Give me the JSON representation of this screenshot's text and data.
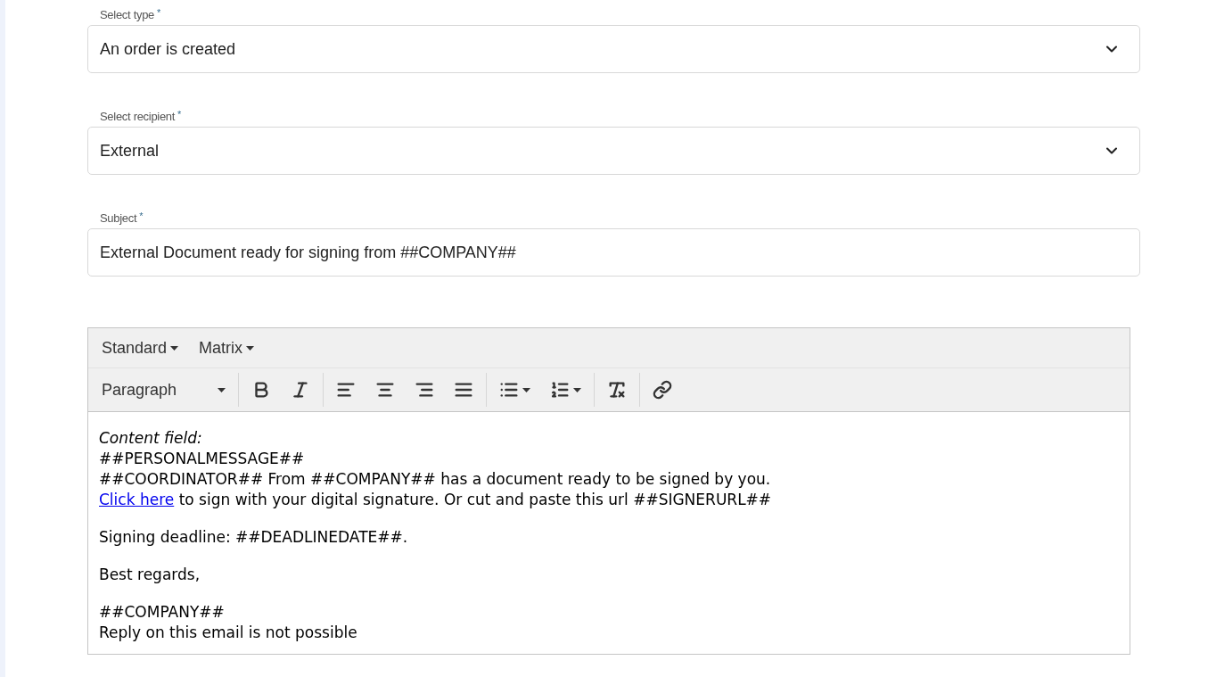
{
  "fields": [
    {
      "kind": "select",
      "label": "Select type",
      "required_mark": "*",
      "value": "An order is created"
    },
    {
      "kind": "select",
      "label": "Select recipient",
      "required_mark": "*",
      "value": "External"
    },
    {
      "kind": "text",
      "label": "Subject",
      "required_mark": "*",
      "value": "External Document ready for signing from ##COMPANY##"
    }
  ],
  "editor": {
    "menus": [
      "Standard",
      "Matrix"
    ],
    "block_format": "Paragraph",
    "tool_groups": [
      [
        {
          "kind": "bold"
        },
        {
          "kind": "italic"
        }
      ],
      [
        {
          "kind": "align-left"
        },
        {
          "kind": "align-center"
        },
        {
          "kind": "align-right"
        },
        {
          "kind": "align-justify"
        }
      ],
      [
        {
          "kind": "bullet-list"
        },
        {
          "kind": "numbered-list"
        }
      ],
      [
        {
          "kind": "clear-format"
        }
      ],
      [
        {
          "kind": "link"
        }
      ]
    ],
    "paragraphs": [
      [
        [
          {
            "kind": "italic",
            "text": "Content field:"
          }
        ],
        [
          {
            "kind": "text",
            "text": "##PERSONALMESSAGE##"
          }
        ],
        [
          {
            "kind": "text",
            "text": "##COORDINATOR## From ##COMPANY## has a document ready to be signed by you."
          }
        ],
        [
          {
            "kind": "link",
            "text": "Click here"
          },
          {
            "kind": "text",
            "text": " to sign with your digital signature. Or cut and paste this url ##SIGNERURL##"
          }
        ]
      ],
      [
        [
          {
            "kind": "text",
            "text": "Signing deadline: ##DEADLINEDATE##."
          }
        ]
      ],
      [
        [
          {
            "kind": "text",
            "text": "Best regards,"
          }
        ]
      ],
      [
        [
          {
            "kind": "text",
            "text": "##COMPANY##"
          }
        ],
        [
          {
            "kind": "text",
            "text": "Reply on this email is not possible"
          }
        ]
      ]
    ]
  }
}
